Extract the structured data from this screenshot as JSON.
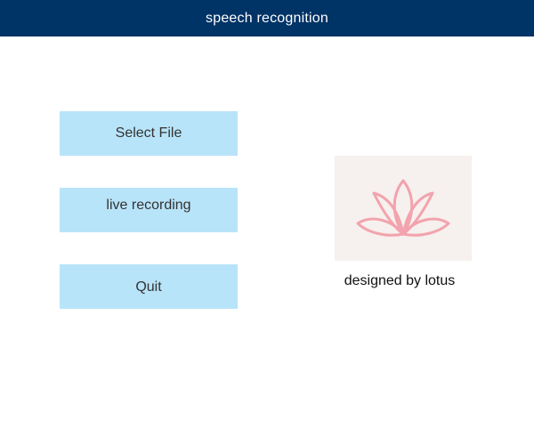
{
  "window": {
    "title": "speech recognition"
  },
  "buttons": {
    "select_file": "Select File",
    "live_recording": "live recording",
    "quit": "Quit"
  },
  "logo": {
    "icon": "lotus-icon",
    "caption": "designed by lotus"
  },
  "colors": {
    "title_bar": "#003366",
    "button_bg": "#b8e4f9",
    "logo_bg": "#f6f0ee",
    "lotus_stroke": "#f2a3ad"
  }
}
